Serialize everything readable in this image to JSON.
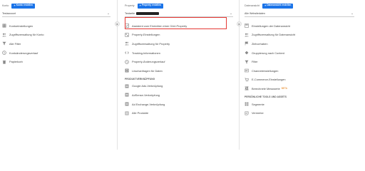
{
  "account": {
    "title": "Konto",
    "create_label": "Konto erstellen",
    "selector_value": "Testaccount",
    "items": [
      {
        "label": "Kontoeinstellungen",
        "icon": "building-icon"
      },
      {
        "label": "Zugriffsverwaltung für Konto",
        "icon": "users-icon"
      },
      {
        "label": "Alle Filter",
        "icon": "filter-icon"
      },
      {
        "label": "Kontoänderungsverlauf",
        "icon": "history-icon"
      },
      {
        "label": "Papierkorb",
        "icon": "trash-icon"
      }
    ]
  },
  "property": {
    "title": "Property",
    "create_label": "Property erstellen",
    "selector_value": "Testseite",
    "items": [
      {
        "label": "Assistent zum Einrichten einer GA4-Property",
        "icon": "check-box-icon"
      },
      {
        "label": "Property-Einstellungen",
        "icon": "property-icon"
      },
      {
        "label": "Zugriffsverwaltung für Property",
        "icon": "users-icon"
      },
      {
        "label": "Tracking-Informationen",
        "icon": "code-icon"
      },
      {
        "label": "Property-Änderungsverlauf",
        "icon": "history-icon"
      },
      {
        "label": "Löschanfragen für Daten",
        "icon": "delete-request-icon"
      }
    ],
    "section_label": "PRODUKTVERKNÜPFUNG",
    "product_items": [
      {
        "label": "Google Ads-Verknüpfung",
        "icon": "google-ads-icon"
      },
      {
        "label": "AdSense-Verknüpfung",
        "icon": "adsense-icon"
      },
      {
        "label": "Ad Exchange-Verknüpfung",
        "icon": "adexchange-icon"
      },
      {
        "label": "Alle Produkte",
        "icon": "all-products-icon"
      }
    ]
  },
  "view": {
    "title": "Datenansicht",
    "create_label": "Datenansicht erstellen",
    "selector_value": "Alle Websitedaten",
    "items": [
      {
        "label": "Einstellungen der Datenansicht",
        "icon": "view-settings-icon"
      },
      {
        "label": "Zugriffsverwaltung für Datenansicht",
        "icon": "users-icon"
      },
      {
        "label": "Zielvorhaben",
        "icon": "flag-icon"
      },
      {
        "label": "Gruppierung nach Content",
        "icon": "content-group-icon"
      },
      {
        "label": "Filter",
        "icon": "filter-icon"
      },
      {
        "label": "Channeleinstellungen",
        "icon": "channel-icon"
      },
      {
        "label": "E-Commerce-Einstellungen",
        "icon": "cart-icon"
      },
      {
        "label": "Berechnete Messwerte",
        "icon": "calc-icon",
        "badge": "BETA"
      }
    ],
    "section_label": "PERSÖNLICHE TOOLS UND ASSETS",
    "tool_items": [
      {
        "label": "Segmente",
        "icon": "segments-icon"
      },
      {
        "label": "Vermerke",
        "icon": "notes-icon"
      }
    ]
  },
  "colors": {
    "accent": "#1a73e8",
    "highlight": "#e53935",
    "beta": "#e37400"
  }
}
